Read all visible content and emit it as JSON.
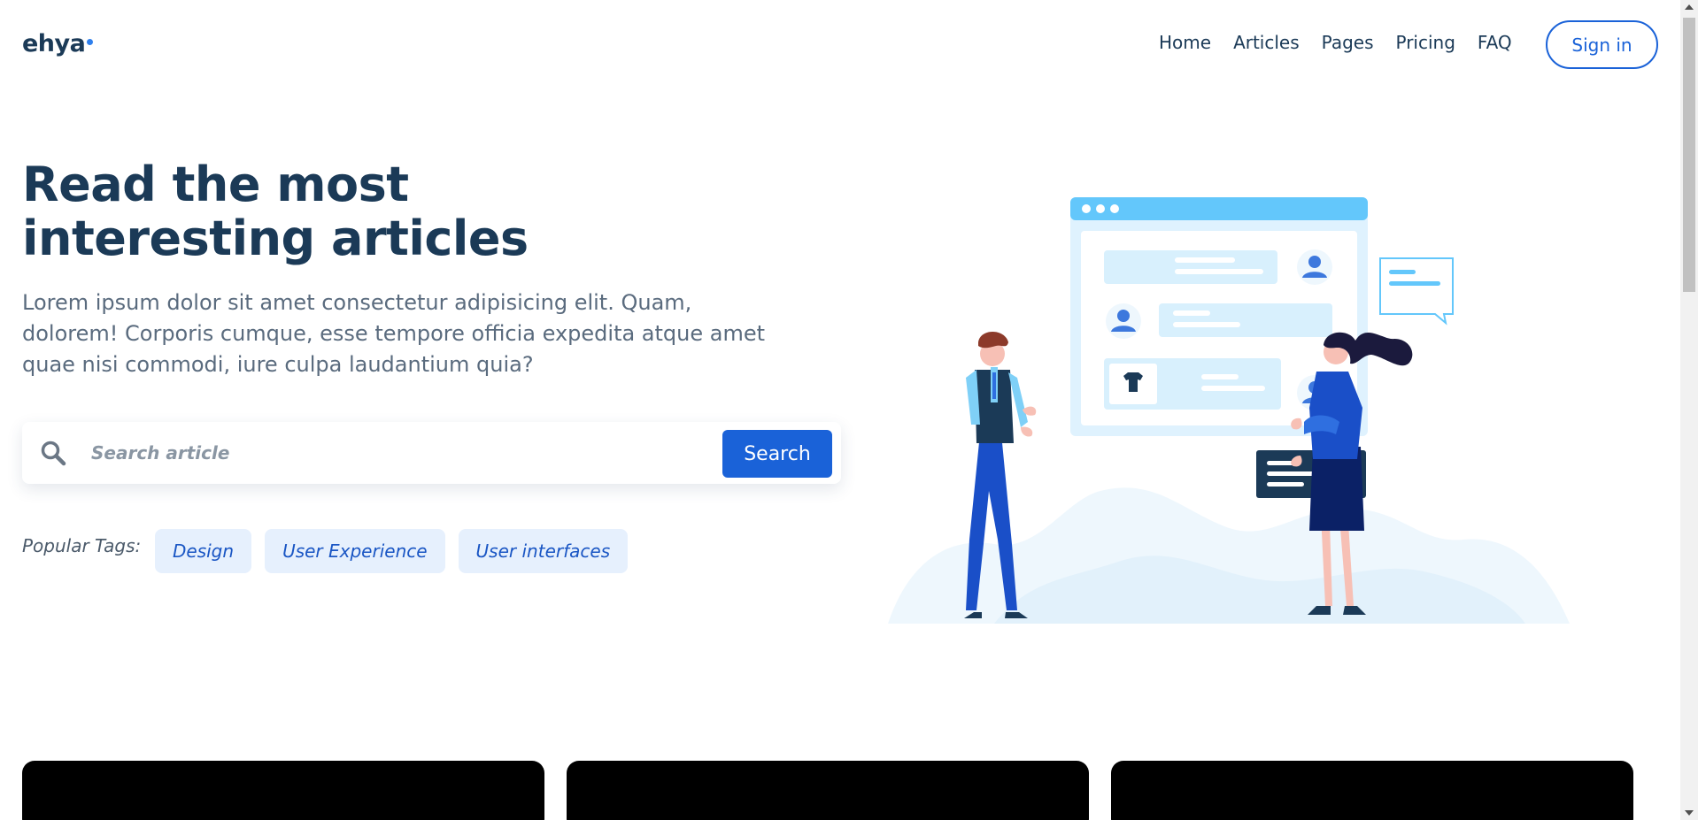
{
  "header": {
    "logo": "ehya",
    "nav": [
      {
        "label": "Home"
      },
      {
        "label": "Articles"
      },
      {
        "label": "Pages"
      },
      {
        "label": "Pricing"
      },
      {
        "label": "FAQ"
      }
    ],
    "signin_label": "Sign in"
  },
  "hero": {
    "title_line1": "Read the most",
    "title_line2": "interesting articles",
    "description": "Lorem ipsum dolor sit amet consectetur adipisicing elit. Quam, dolorem! Corporis cumque, esse tempore officia expedita atque amet quae nisi commodi, iure culpa laudantium quia?"
  },
  "search": {
    "placeholder": "Search article",
    "value": "",
    "button_label": "Search",
    "icon": "search-icon"
  },
  "tags": {
    "label": "Popular Tags:",
    "items": [
      {
        "label": "Design"
      },
      {
        "label": "User Experience"
      },
      {
        "label": "User interfaces"
      }
    ]
  },
  "colors": {
    "primary": "#1a62d8",
    "heading": "#1b3a57",
    "body_text": "#5a6b7e",
    "tag_bg": "#e6f0fd",
    "accent_light": "#63c7fb"
  }
}
